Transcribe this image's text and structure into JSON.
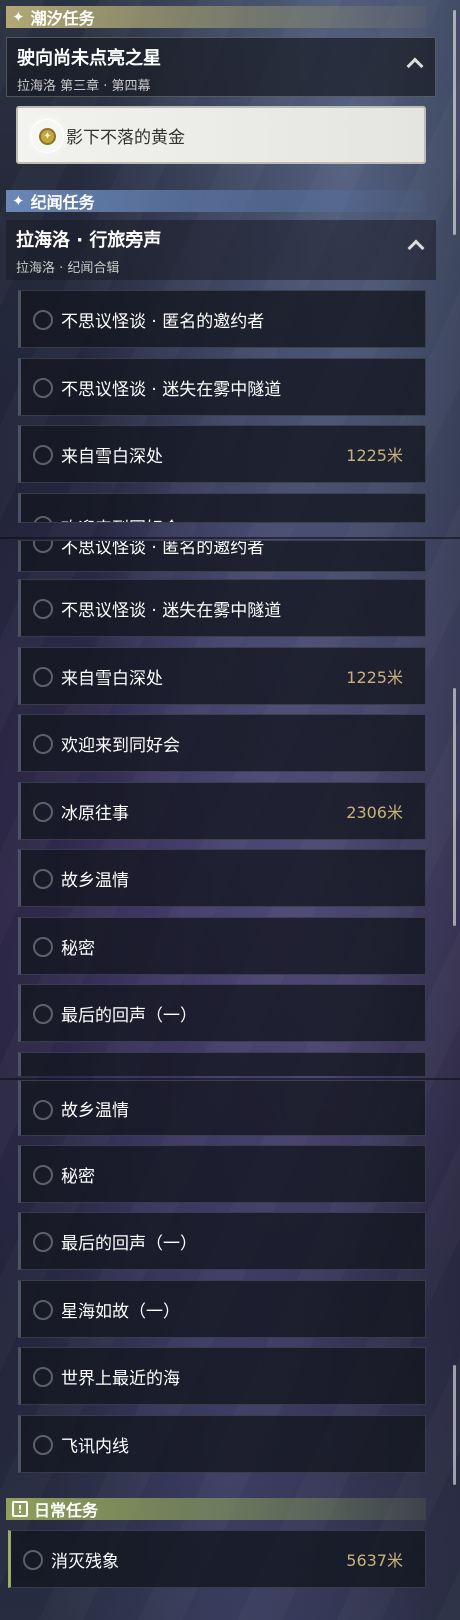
{
  "sections": {
    "tide": {
      "title": "潮汐任务"
    },
    "lore": {
      "title": "纪闻任务"
    },
    "daily": {
      "title": "日常任务"
    }
  },
  "main_chapter": {
    "title": "驶向尚未点亮之星",
    "subtitle": "拉海洛 第三章 · 第四幕"
  },
  "active_quest": {
    "name": "影下不落的黄金"
  },
  "lore_chapter": {
    "title": "拉海洛 · 行旅旁声",
    "subtitle": "拉海洛 · 纪闻合辑"
  },
  "quests_part1": [
    {
      "name": "不思议怪谈 · 匿名的邀约者",
      "dist": ""
    },
    {
      "name": "不思议怪谈 · 迷失在雾中隧道",
      "dist": ""
    },
    {
      "name": "来自雪白深处",
      "dist": "1225米"
    },
    {
      "name": "欢迎来到同好会",
      "dist": ""
    }
  ],
  "quests_part2": [
    {
      "name": "不思议怪谈 · 匿名的邀约者",
      "dist": ""
    },
    {
      "name": "不思议怪谈 · 迷失在雾中隧道",
      "dist": ""
    },
    {
      "name": "来自雪白深处",
      "dist": "1225米"
    },
    {
      "name": "欢迎来到同好会",
      "dist": ""
    },
    {
      "name": "冰原往事",
      "dist": "2306米"
    },
    {
      "name": "故乡温情",
      "dist": ""
    },
    {
      "name": "秘密",
      "dist": ""
    },
    {
      "name": "最后的回声（一）",
      "dist": ""
    }
  ],
  "quests_part3": [
    {
      "name": "故乡温情",
      "dist": ""
    },
    {
      "name": "秘密",
      "dist": ""
    },
    {
      "name": "最后的回声（一）",
      "dist": ""
    },
    {
      "name": "星海如故（一）",
      "dist": ""
    },
    {
      "name": "世界上最近的海",
      "dist": ""
    },
    {
      "name": "飞讯内线",
      "dist": ""
    }
  ],
  "daily_quest": {
    "name": "消灭残象",
    "dist": "5637米"
  },
  "icons": {
    "section_tide": "sparkle-icon",
    "section_lore": "sparkle-icon",
    "section_daily": "exclamation-icon",
    "active_quest": "compass-icon",
    "expand": "chevron-up-icon"
  },
  "colors": {
    "tide_accent": "#b9af78",
    "lore_accent": "#6e8cbe",
    "daily_accent": "#96a55f",
    "distance": "#c8b27a"
  }
}
